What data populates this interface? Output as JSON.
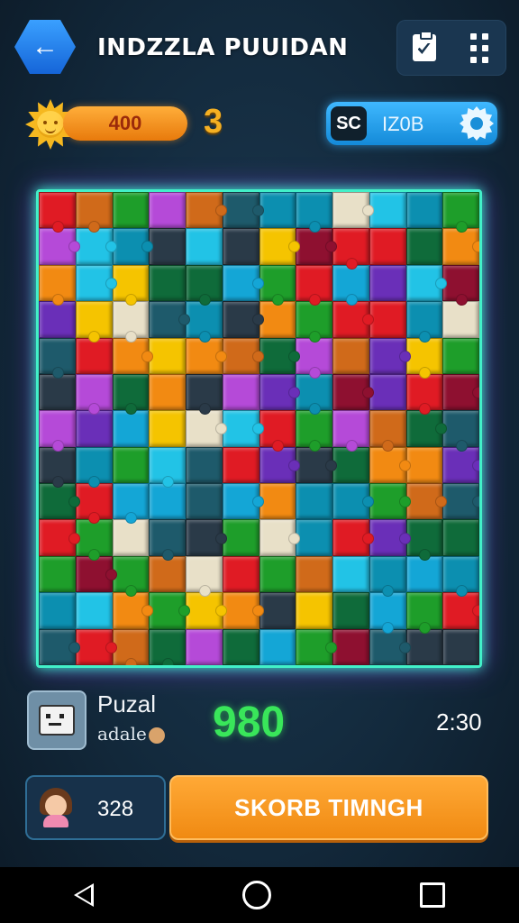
{
  "header": {
    "title": "INDZZLA PUUIDAN"
  },
  "stats": {
    "score_pill": "400",
    "level": "3",
    "timer_badge": "SC",
    "timer_value": "IZ0B"
  },
  "board": {
    "columns": 12,
    "rows": 13,
    "palette": [
      "#0c8fb0",
      "#14a6d6",
      "#1e5a6b",
      "#6a2fb8",
      "#e01b24",
      "#f5c400",
      "#f28a12",
      "#1e9e2a",
      "#0f6b3a",
      "#8e1030",
      "#e8e0c8",
      "#2a3a48",
      "#22c3e6",
      "#b54ad8",
      "#d06a1a"
    ]
  },
  "player": {
    "name": "Puzal",
    "subtitle": "adale",
    "score": "980",
    "time": "2:30"
  },
  "bottom": {
    "player_score": "328",
    "action_label": "SKORB TIMNGH"
  }
}
